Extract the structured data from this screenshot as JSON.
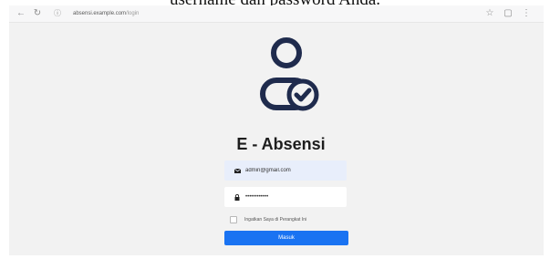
{
  "document": {
    "caption": "username dan password Anda."
  },
  "browser": {
    "url_host": "absensi.example.com",
    "url_path": "/login"
  },
  "app": {
    "title": "E - Absensi"
  },
  "form": {
    "email_value": "admin@gmail.com",
    "password_value": "••••••••••••",
    "remember_label": "Ingatkan Saya di Perangkat Ini",
    "submit_label": "Masuk"
  },
  "colors": {
    "accent": "#1a73f2",
    "logo": "#1f2b4d",
    "email_field_bg": "#e8eefb",
    "page_bg": "#f2f2f2"
  },
  "icons": {
    "back": "arrow-left-icon",
    "reload": "reload-icon",
    "logo": "user-check-icon",
    "email": "envelope-icon",
    "password": "lock-icon",
    "browser_actions": [
      "star-icon",
      "more-icon"
    ]
  }
}
